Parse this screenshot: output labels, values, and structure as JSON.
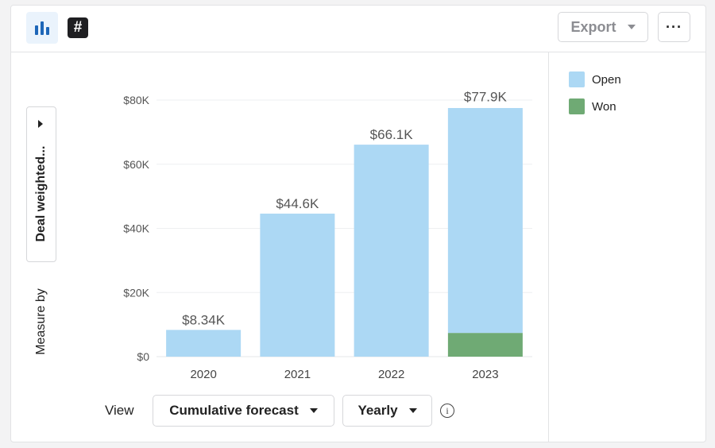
{
  "header": {
    "chart_view_icon": "bar-chart-icon",
    "number_view_icon": "hash-icon",
    "export_label": "Export",
    "more_label": "···"
  },
  "controls": {
    "measure_by_label": "Measure by",
    "measure_value": "Deal weighted...",
    "view_label": "View",
    "view_value": "Cumulative forecast",
    "period_value": "Yearly",
    "info_icon": "i"
  },
  "legend": [
    {
      "label": "Open",
      "color": "#acd8f4"
    },
    {
      "label": "Won",
      "color": "#6faa74"
    }
  ],
  "chart_data": {
    "type": "bar",
    "stacked": true,
    "categories": [
      "2020",
      "2021",
      "2022",
      "2023"
    ],
    "series": [
      {
        "name": "Won",
        "color": "#6faa74",
        "values": [
          0,
          0,
          0,
          7400
        ]
      },
      {
        "name": "Open",
        "color": "#acd8f4",
        "values": [
          8340,
          44600,
          66100,
          70500
        ]
      }
    ],
    "totals": [
      8340,
      44600,
      66100,
      77900
    ],
    "total_labels": [
      "$8.34K",
      "$44.6K",
      "$66.1K",
      "$77.9K"
    ],
    "yticks": [
      0,
      20000,
      40000,
      60000,
      80000
    ],
    "ytick_labels": [
      "$0",
      "$20K",
      "$40K",
      "$60K",
      "$80K"
    ],
    "ylim": [
      0,
      80000
    ],
    "title": "",
    "xlabel": "",
    "ylabel": "Measure by",
    "grid": true,
    "legend_position": "right"
  }
}
